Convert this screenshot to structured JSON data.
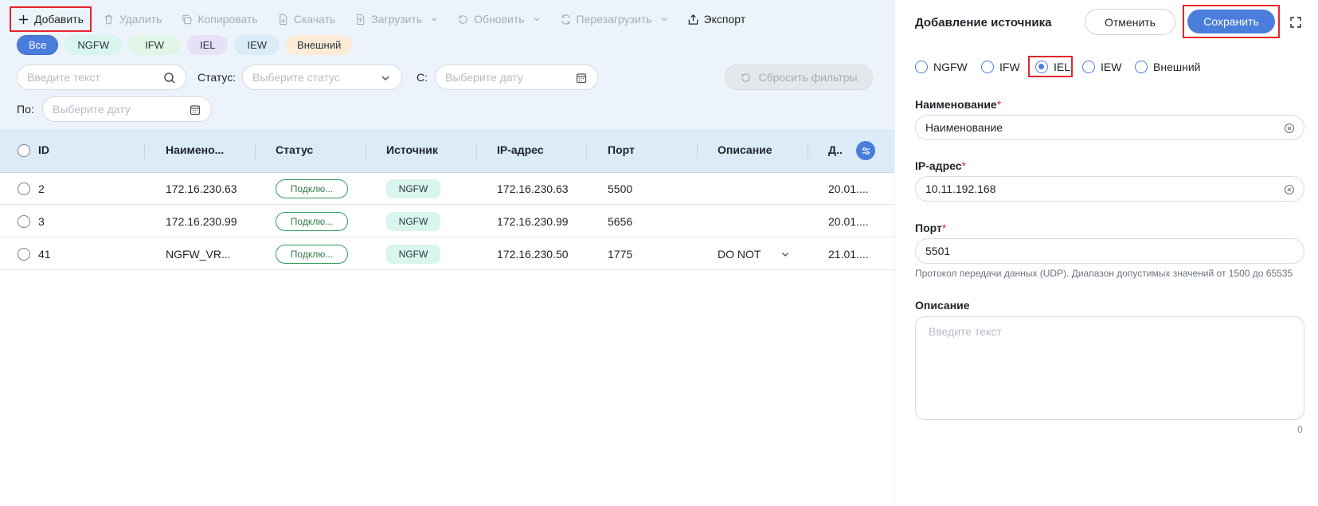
{
  "toolbar": {
    "add": "Добавить",
    "delete": "Удалить",
    "copy": "Копировать",
    "download": "Скачать",
    "upload": "Загрузить",
    "refresh": "Обновить",
    "reboot": "Перезагрузить",
    "export": "Экспорт"
  },
  "chips": [
    "Все",
    "NGFW",
    "IFW",
    "IEL",
    "IEW",
    "Внешний"
  ],
  "filters": {
    "search_placeholder": "Введите текст",
    "status_label": "Статус:",
    "status_placeholder": "Выберите статус",
    "from_label": "С:",
    "from_placeholder": "Выберите дату",
    "to_label": "По:",
    "to_placeholder": "Выберите дату",
    "reset": "Сбросить фильтры"
  },
  "table": {
    "columns": [
      "ID",
      "Наимено...",
      "Статус",
      "Источник",
      "IP-адрес",
      "Порт",
      "Описание",
      "Д.."
    ],
    "rows": [
      {
        "id": "2",
        "name": "172.16.230.63",
        "status": "Подклю...",
        "source": "NGFW",
        "ip": "172.16.230.63",
        "port": "5500",
        "desc": "",
        "date": "20.01...."
      },
      {
        "id": "3",
        "name": "172.16.230.99",
        "status": "Подклю...",
        "source": "NGFW",
        "ip": "172.16.230.99",
        "port": "5656",
        "desc": "",
        "date": "20.01...."
      },
      {
        "id": "41",
        "name": "NGFW_VR...",
        "status": "Подклю...",
        "source": "NGFW",
        "ip": "172.16.230.50",
        "port": "1775",
        "desc": "DO NOT",
        "date": "21.01...."
      }
    ]
  },
  "panel": {
    "title": "Добавление источника",
    "cancel": "Отменить",
    "save": "Сохранить",
    "radio_options": [
      "NGFW",
      "IFW",
      "IEL",
      "IEW",
      "Внешний"
    ],
    "selected_radio": "IEL",
    "name_label": "Наименование",
    "name_value": "Наименование",
    "ip_label": "IP-адрес",
    "ip_value": "10.11.192.168",
    "port_label": "Порт",
    "port_value": "5501",
    "port_hint": "Протокол передачи данных (UDP). Диапазон допустимых значений от 1500 до 65535",
    "desc_label": "Описание",
    "desc_placeholder": "Введите текст",
    "desc_counter": "0",
    "required_mark": "*"
  },
  "colors": {
    "accent": "#4b7ddd",
    "highlight": "#e5252a",
    "header_bg": "#dbebf8",
    "top_bg": "#edf3fb"
  }
}
